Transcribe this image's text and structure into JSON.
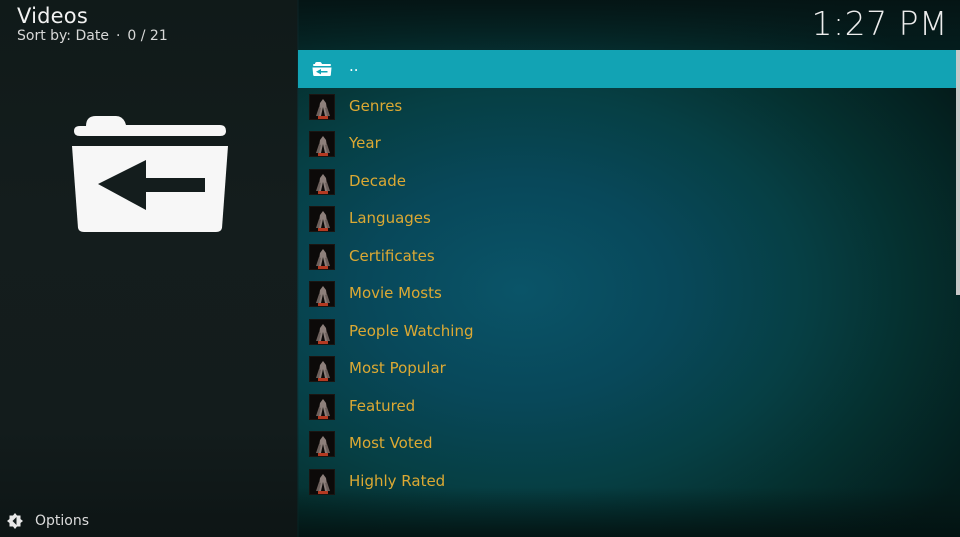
{
  "header": {
    "title": "Videos",
    "sort_label": "Sort by: Date",
    "separator": "·",
    "position": "0 / 21"
  },
  "clock": "1:27 PM",
  "footer": {
    "options_label": "Options",
    "options_icon": "options-gear-icon"
  },
  "preview": {
    "icon": "folder-back-icon"
  },
  "list": {
    "items": [
      {
        "label": "..",
        "icon": "folder-up-icon",
        "selected": true
      },
      {
        "label": "Genres",
        "icon": "addon-thumbnail"
      },
      {
        "label": "Year",
        "icon": "addon-thumbnail"
      },
      {
        "label": "Decade",
        "icon": "addon-thumbnail"
      },
      {
        "label": "Languages",
        "icon": "addon-thumbnail"
      },
      {
        "label": "Certificates",
        "icon": "addon-thumbnail"
      },
      {
        "label": "Movie Mosts",
        "icon": "addon-thumbnail"
      },
      {
        "label": "People Watching",
        "icon": "addon-thumbnail"
      },
      {
        "label": "Most Popular",
        "icon": "addon-thumbnail"
      },
      {
        "label": "Featured",
        "icon": "addon-thumbnail"
      },
      {
        "label": "Most Voted",
        "icon": "addon-thumbnail"
      },
      {
        "label": "Highly Rated",
        "icon": "addon-thumbnail"
      }
    ]
  },
  "colors": {
    "accent": "#12a3b4",
    "item_text": "#dca933",
    "selected_text": "#ffffff"
  }
}
